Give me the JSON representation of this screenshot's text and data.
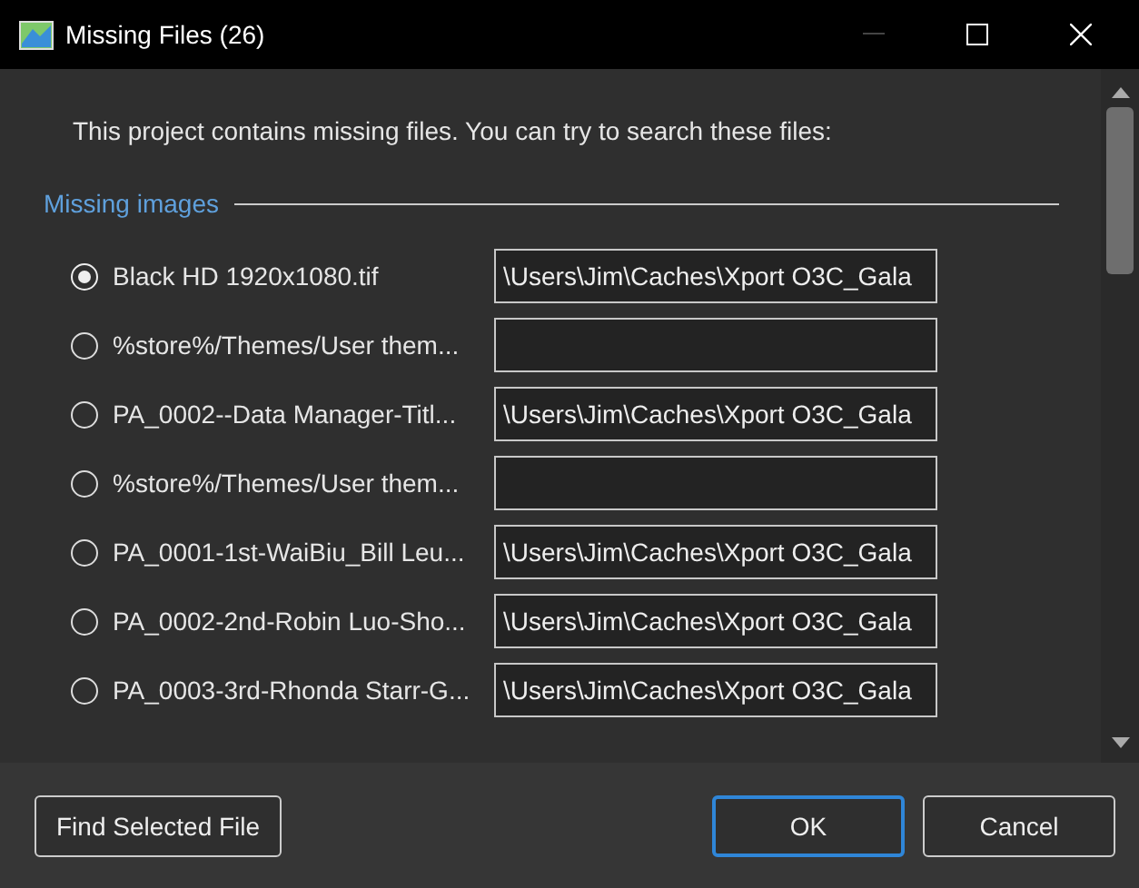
{
  "window": {
    "title": "Missing Files (26)",
    "minimize_disabled": true
  },
  "intro": "This project contains missing files. You can try to search these files:",
  "section": {
    "title": "Missing images"
  },
  "files": [
    {
      "label": "Black HD 1920x1080.tif",
      "selected": true,
      "path": "\\Users\\Jim\\Caches\\Xport O3C_Gala"
    },
    {
      "label": "%store%/Themes/User them...",
      "selected": false
    },
    {
      "label": "PA_0002--Data Manager-Titl...",
      "selected": false,
      "path": "\\Users\\Jim\\Caches\\Xport O3C_Gala"
    },
    {
      "label": "%store%/Themes/User them...",
      "selected": false
    },
    {
      "label": "PA_0001-1st-WaiBiu_Bill Leu...",
      "selected": false,
      "path": "\\Users\\Jim\\Caches\\Xport O3C_Gala"
    },
    {
      "label": "PA_0002-2nd-Robin Luo-Sho...",
      "selected": false,
      "path": "\\Users\\Jim\\Caches\\Xport O3C_Gala"
    },
    {
      "label": "PA_0003-3rd-Rhonda Starr-G...",
      "selected": false,
      "path": "\\Users\\Jim\\Caches\\Xport O3C_Gala"
    }
  ],
  "buttons": {
    "find": "Find Selected File",
    "ok": "OK",
    "cancel": "Cancel"
  }
}
